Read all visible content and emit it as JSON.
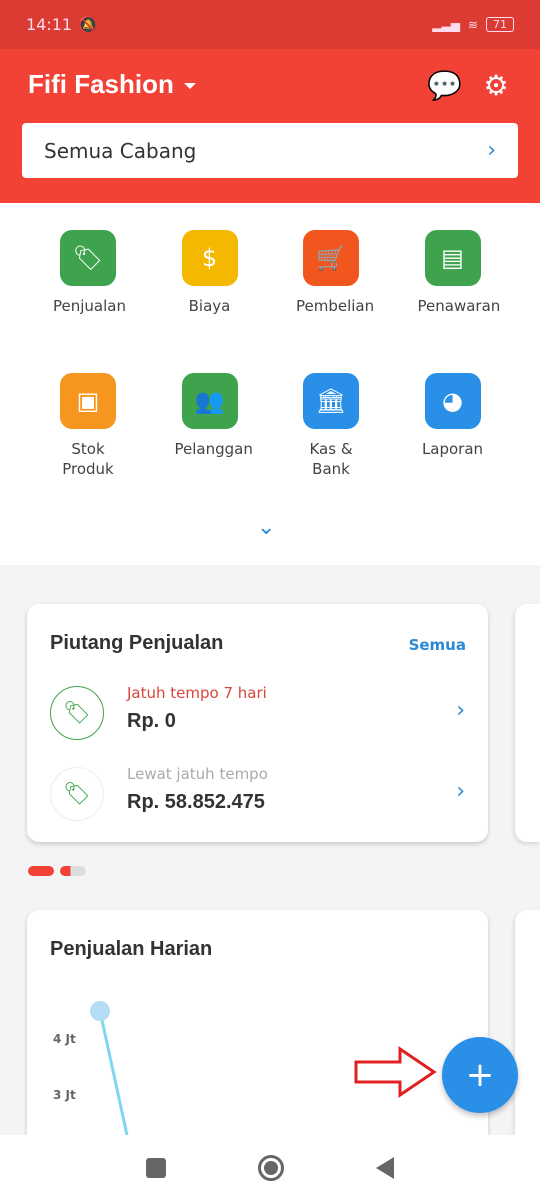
{
  "status": {
    "time": "14:11",
    "battery": "71"
  },
  "header": {
    "title": "Fifi Fashion",
    "branch": "Semua Cabang"
  },
  "menu": [
    {
      "label": "Penjualan",
      "icon": "price-tag-icon",
      "color": "#3fa34d"
    },
    {
      "label": "Biaya",
      "icon": "money-bag-icon",
      "color": "#f5b800"
    },
    {
      "label": "Pembelian",
      "icon": "cart-icon",
      "color": "#f1561f"
    },
    {
      "label": "Penawaran",
      "icon": "document-rp-icon",
      "color": "#3fa34d"
    },
    {
      "label": "Stok Produk",
      "icon": "box-icon",
      "color": "#f7961e"
    },
    {
      "label": "Pelanggan",
      "icon": "users-icon",
      "color": "#3fa34d"
    },
    {
      "label": "Kas & Bank",
      "icon": "bank-icon",
      "color": "#2a8fe6"
    },
    {
      "label": "Laporan",
      "icon": "pie-chart-icon",
      "color": "#2a8fe6"
    }
  ],
  "receivables": {
    "title": "Piutang Penjualan",
    "all": "Semua",
    "rows": [
      {
        "label": "Jatuh tempo 7 hari",
        "value": "Rp. 0",
        "color": "#d9453a"
      },
      {
        "label": "Lewat jatuh tempo",
        "value": "Rp. 58.852.475",
        "color": "#aaa"
      }
    ]
  },
  "daily": {
    "title": "Penjualan Harian",
    "ticks": [
      "4 Jt",
      "3 Jt"
    ]
  },
  "colors": {
    "primary": "#f24236",
    "accent": "#2a8fe6"
  }
}
